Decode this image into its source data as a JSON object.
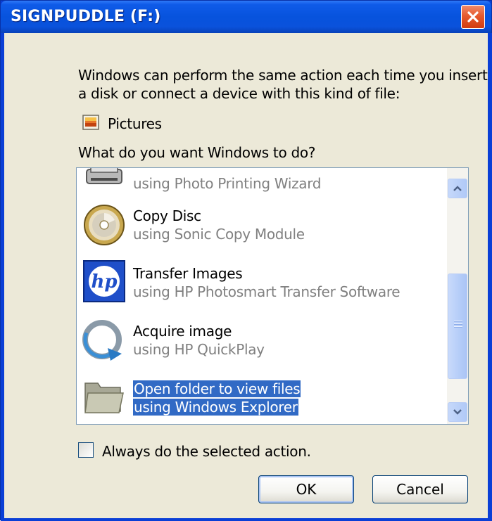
{
  "window": {
    "title": "SIGNPUDDLE (F:)",
    "colors": {
      "titlebar": "#0753dd",
      "client": "#ece9d8",
      "selection": "#316ac5"
    }
  },
  "intro": {
    "line1": "Windows can perform the same action each time you insert",
    "line2": "a disk or connect a device with this kind of file:"
  },
  "content_type": {
    "icon": "pictures-icon",
    "label": "Pictures"
  },
  "prompt": "What do you want Windows to do?",
  "actions": [
    {
      "icon": "printer-icon",
      "name": "",
      "sub": "using Photo Printing Wizard"
    },
    {
      "icon": "disc-icon",
      "name": "Copy Disc",
      "sub": "using Sonic Copy Module"
    },
    {
      "icon": "hp-logo-icon",
      "name": "Transfer Images",
      "sub": "using HP Photosmart Transfer Software"
    },
    {
      "icon": "quickplay-icon",
      "name": "Acquire image",
      "sub": "using HP QuickPlay"
    },
    {
      "icon": "folder-icon",
      "name": "Open folder to view files",
      "sub": "using Windows Explorer",
      "selected": true
    }
  ],
  "always_checkbox": {
    "label": "Always do the selected action.",
    "checked": false
  },
  "buttons": {
    "ok": "OK",
    "cancel": "Cancel"
  }
}
